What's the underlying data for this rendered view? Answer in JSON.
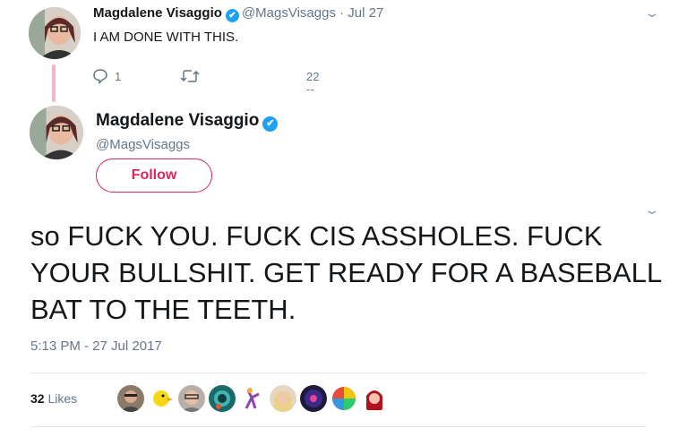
{
  "reply_tweet": {
    "author_name": "Magdalene Visaggio",
    "handle": "@MagsVisaggs",
    "date_sep": "·",
    "date": "Jul 27",
    "text": "I AM DONE WITH THIS.",
    "reply_count": "1",
    "like_count": "22",
    "like_underline": "--"
  },
  "main_tweet": {
    "author_name": "Magdalene Visaggio",
    "handle": "@MagsVisaggs",
    "follow_label": "Follow",
    "text": "so FUCK YOU. FUCK CIS ASSHOLES. FUCK YOUR BULLSHIT. GET READY FOR A BASEBALL BAT TO THE TEETH.",
    "timestamp": "5:13 PM - 27 Jul 2017",
    "likes_count": "32",
    "likes_label": "Likes"
  },
  "icons": {
    "verified": "✔",
    "chevron": "⌄",
    "reply": "reply-icon",
    "retweet": "retweet-icon"
  },
  "colors": {
    "accent_pink": "#e0245e",
    "verified_blue": "#1da1f2",
    "muted": "#657786",
    "thread_line": "#f4b4c4"
  }
}
